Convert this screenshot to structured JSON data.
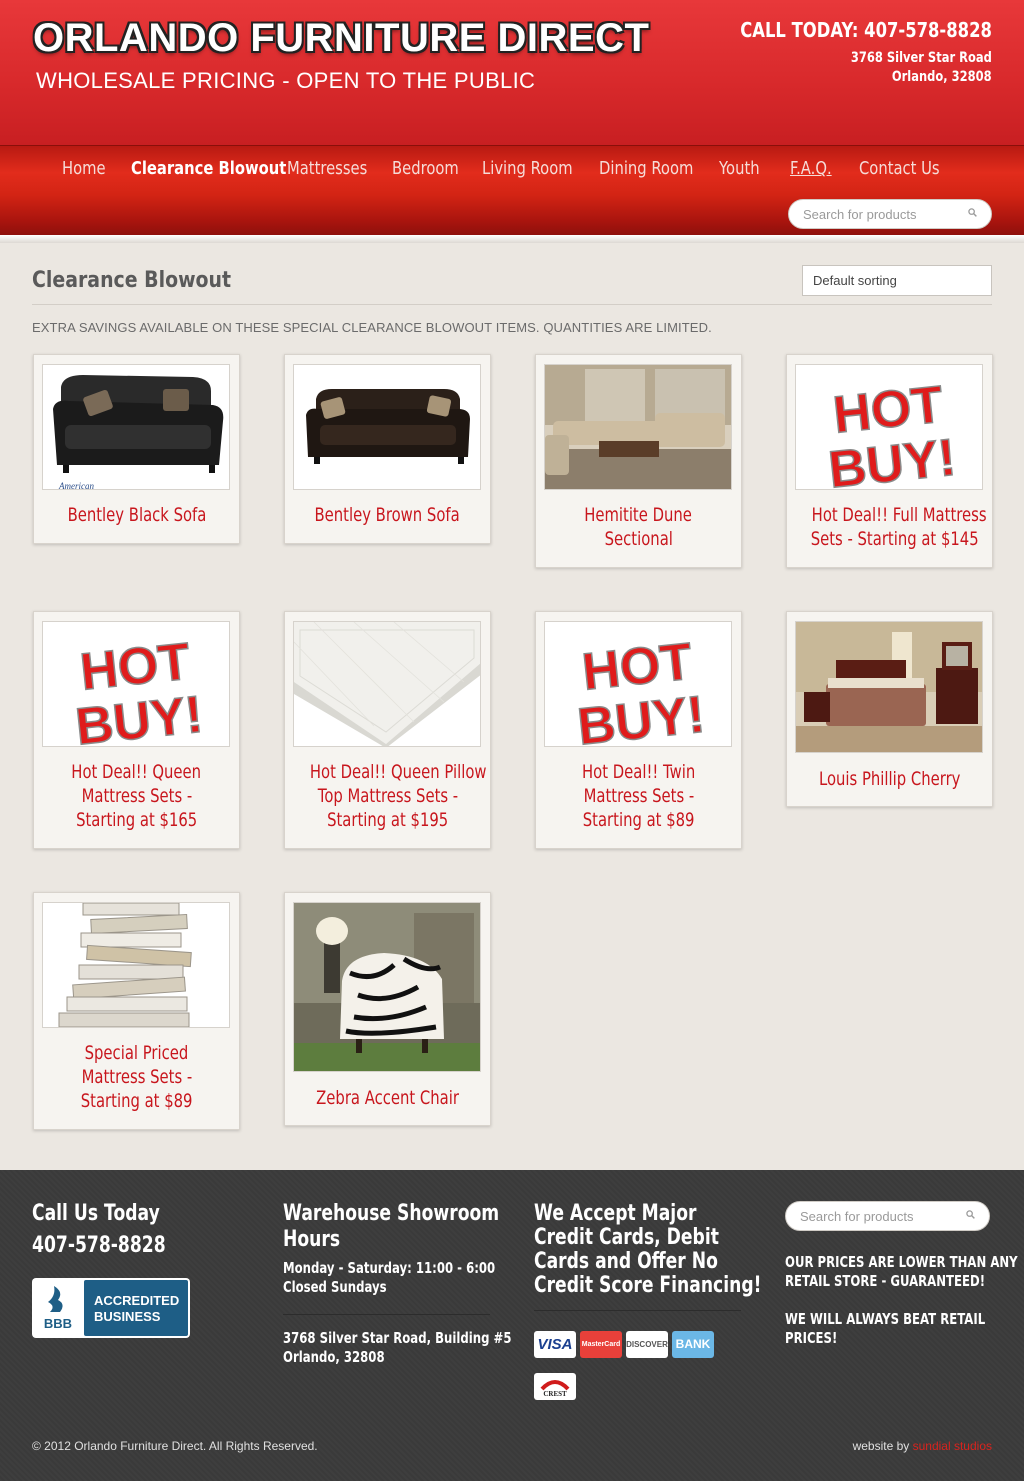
{
  "header": {
    "site_title": "ORLANDO FURNITURE DIRECT",
    "tagline": "WHOLESALE PRICING - OPEN TO THE PUBLIC",
    "call": "CALL TODAY: 407-578-8828",
    "address_line1": "3768 Silver Star Road",
    "address_line2": "Orlando, 32808"
  },
  "nav": {
    "items": [
      {
        "label": "Home"
      },
      {
        "label": "Clearance Blowout",
        "active": true
      },
      {
        "label": "Mattresses"
      },
      {
        "label": "Bedroom"
      },
      {
        "label": "Living Room"
      },
      {
        "label": "Dining Room"
      },
      {
        "label": "Youth"
      },
      {
        "label": "F.A.Q."
      },
      {
        "label": "Contact Us"
      }
    ],
    "search_placeholder": "Search for products"
  },
  "content": {
    "page_title": "Clearance Blowout",
    "sorting": "Default sorting",
    "notice": "EXTRA SAVINGS AVAILABLE ON THESE SPECIAL CLEARANCE BLOWOUT ITEMS. QUANTITIES ARE LIMITED.",
    "products": [
      {
        "title_lines": [
          "Bentley Black Sofa"
        ],
        "image": "black-leather-sofa",
        "image_text": "American"
      },
      {
        "title_lines": [
          "Bentley Brown Sofa"
        ],
        "image": "brown-leather-sofa"
      },
      {
        "title_lines": [
          "Hemitite Dune",
          "Sectional"
        ],
        "image": "sectional-room"
      },
      {
        "title_lines": [
          "Hot Deal!! Full Mattress",
          "Sets - Starting at $145"
        ],
        "image": "hot-buy",
        "image_text": [
          "HOT",
          "BUY!"
        ]
      },
      {
        "title_lines": [
          "Hot Deal!! Queen",
          "Mattress Sets -",
          "Starting at $165"
        ],
        "image": "hot-buy",
        "image_text": [
          "HOT",
          "BUY!"
        ]
      },
      {
        "title_lines": [
          "Hot Deal!! Queen Pillow",
          "Top Mattress Sets -",
          "Starting at $195"
        ],
        "image": "mattress"
      },
      {
        "title_lines": [
          "Hot Deal!! Twin",
          "Mattress Sets -",
          "Starting at $89"
        ],
        "image": "hot-buy",
        "image_text": [
          "HOT",
          "BUY!"
        ]
      },
      {
        "title_lines": [
          "Louis Phillip Cherry"
        ],
        "image": "bedroom-set"
      },
      {
        "title_lines": [
          "Special Priced",
          "Mattress Sets -",
          "Starting at $89"
        ],
        "image": "mattress-stack"
      },
      {
        "title_lines": [
          "Zebra Accent Chair"
        ],
        "image": "zebra-chair"
      }
    ]
  },
  "footer": {
    "col1_heading": "Call Us Today",
    "col1_phone": "407-578-8828",
    "bbb": {
      "line1": "ACCREDITED",
      "line2": "BUSINESS",
      "logo_text": "BBB"
    },
    "col2_heading_1": "Warehouse Showroom",
    "col2_heading_2": "Hours",
    "hours_1": "Monday - Saturday: 11:00 - 6:00",
    "hours_2": "Closed Sundays",
    "address_1": "3768 Silver Star Road, Building #5",
    "address_2": "Orlando, 32808",
    "col3_heading": [
      "We Accept Major",
      "Credit Cards, Debit",
      "Cards and Offer No",
      "Credit Score Financing!"
    ],
    "cards": [
      {
        "label": "VISA",
        "color": "#1a3f8f"
      },
      {
        "label": "MasterCard",
        "color": "#f0a11b"
      },
      {
        "label": "DISCOVER",
        "color": "#e57c1f"
      },
      {
        "label": "BANK",
        "color": "#6bb7e6"
      }
    ],
    "crest_label": "CREST",
    "search_placeholder": "Search for products",
    "promo_1": [
      "OUR PRICES ARE LOWER THAN ANY",
      "RETAIL STORE - GUARANTEED!"
    ],
    "promo_2": [
      "WE WILL ALWAYS BEAT RETAIL",
      "PRICES!"
    ],
    "copyright": "© 2012 Orlando Furniture Direct. All Rights Reserved.",
    "credit_prefix": "website by",
    "credit_name": "sundial studios"
  },
  "colors": {
    "brand_red": "#d92a2c",
    "link_red": "#c8161d",
    "footer_bg": "#3a3a3a"
  }
}
